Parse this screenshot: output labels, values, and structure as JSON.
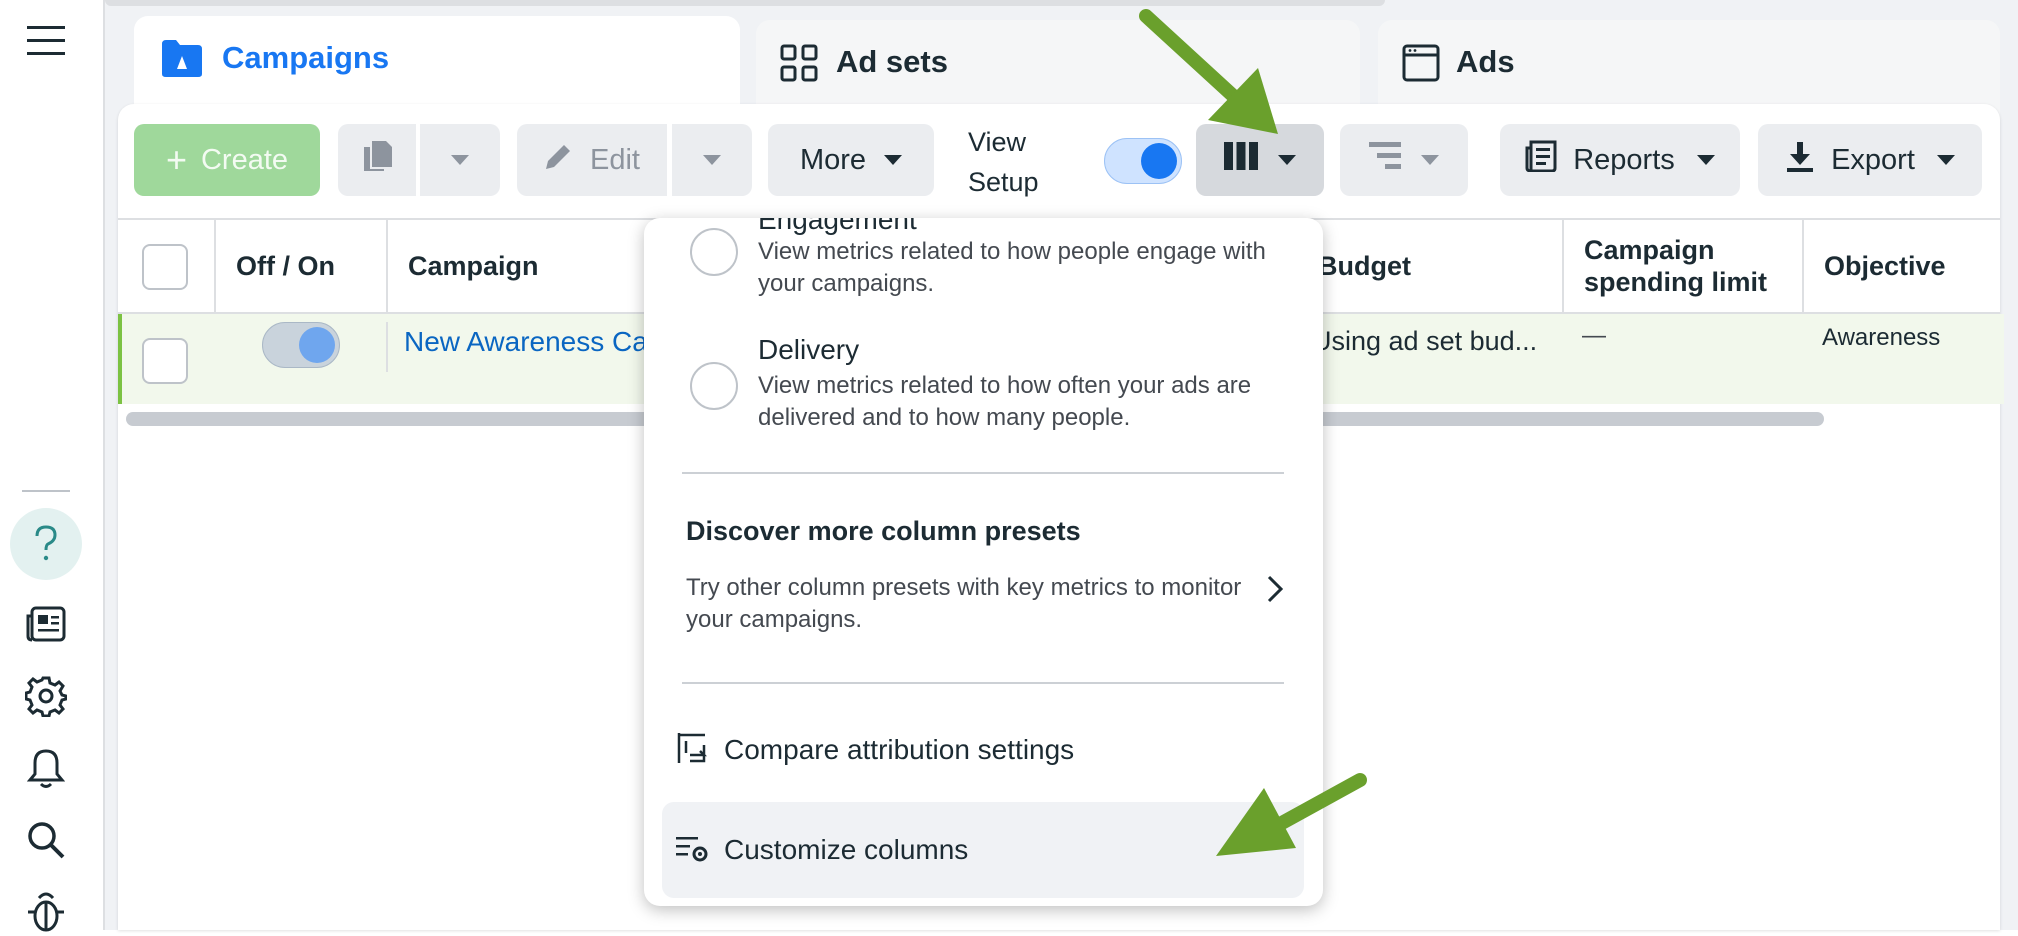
{
  "tabs": {
    "campaigns": "Campaigns",
    "adsets": "Ad sets",
    "ads": "Ads"
  },
  "toolbar": {
    "create": "Create",
    "edit": "Edit",
    "more": "More",
    "view_setup_line1": "View",
    "view_setup_line2": "Setup",
    "reports": "Reports",
    "export": "Export"
  },
  "table": {
    "headers": {
      "off_on": "Off / On",
      "campaign": "Campaign",
      "budget": "Budget",
      "spending_limit_line1": "Campaign",
      "spending_limit_line2": "spending limit",
      "objective": "Objective"
    },
    "row": {
      "campaign": "New Awareness Ca",
      "budget": "Using ad set bud...",
      "spending_limit": "—",
      "objective": "Awareness"
    }
  },
  "dropdown": {
    "engagement": {
      "title": "Engagement",
      "desc": "View metrics related to how people engage with your campaigns."
    },
    "delivery": {
      "title": "Delivery",
      "desc": "View metrics related to how often your ads are delivered and to how many people."
    },
    "discover": {
      "title": "Discover more column presets",
      "desc": "Try other column presets with key metrics to monitor your campaigns."
    },
    "compare": "Compare attribution settings",
    "customize": "Customize columns"
  },
  "colors": {
    "accent": "#1877f2",
    "link": "#0a66c2",
    "create_green": "#9fd89b",
    "arrow_green": "#6aa02c",
    "row_highlight": "#f2f8ec"
  },
  "icons": [
    "menu-icon",
    "campaigns-folder-icon",
    "adsets-grid-icon",
    "ads-window-icon",
    "duplicate-icon",
    "pencil-icon",
    "columns-icon",
    "breakdown-icon",
    "reports-icon",
    "download-icon",
    "help-icon",
    "news-icon",
    "gear-icon",
    "bell-icon",
    "search-icon",
    "bug-icon",
    "compare-attribution-icon",
    "customize-columns-icon",
    "chevron-right-icon"
  ]
}
